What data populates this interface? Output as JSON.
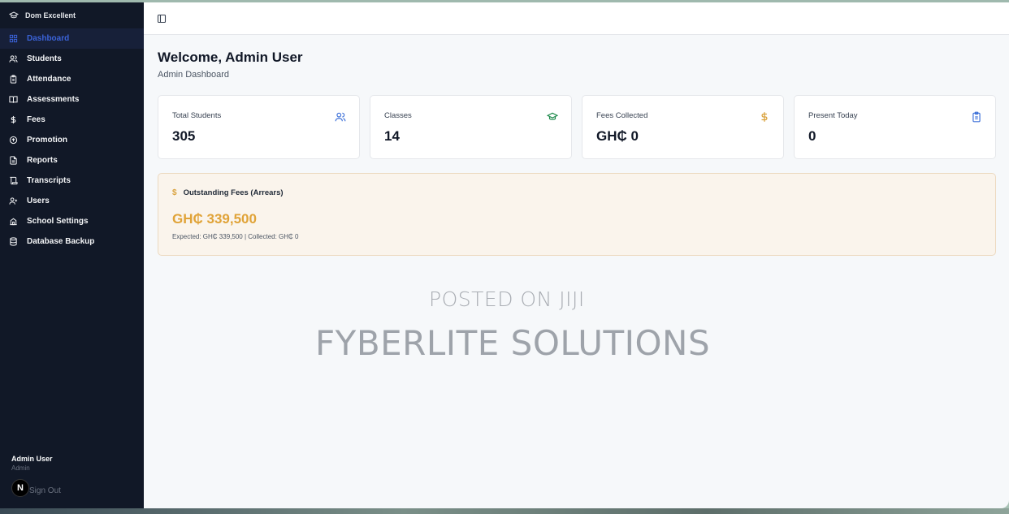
{
  "sidebar": {
    "brand": "Dom Excellent",
    "items": [
      {
        "label": "Dashboard",
        "icon": "dashboard-icon",
        "active": true
      },
      {
        "label": "Students",
        "icon": "users-icon"
      },
      {
        "label": "Attendance",
        "icon": "clipboard-icon"
      },
      {
        "label": "Assessments",
        "icon": "book-open-icon"
      },
      {
        "label": "Fees",
        "icon": "dollar-icon"
      },
      {
        "label": "Promotion",
        "icon": "arrow-circle-icon"
      },
      {
        "label": "Reports",
        "icon": "file-icon"
      },
      {
        "label": "Transcripts",
        "icon": "scroll-icon"
      },
      {
        "label": "Users",
        "icon": "user-plus-icon"
      },
      {
        "label": "School Settings",
        "icon": "school-icon"
      },
      {
        "label": "Database Backup",
        "icon": "database-icon"
      }
    ],
    "user": {
      "name": "Admin User",
      "role": "Admin"
    },
    "signout_label": "Sign Out",
    "next_badge": "N"
  },
  "header": {
    "welcome": "Welcome, Admin User",
    "subtitle": "Admin Dashboard"
  },
  "stats": [
    {
      "label": "Total Students",
      "value": "305",
      "icon": "users-icon",
      "color": "#3b6fd8"
    },
    {
      "label": "Classes",
      "value": "14",
      "icon": "graduation-cap-icon",
      "color": "#1f8a4c"
    },
    {
      "label": "Fees Collected",
      "value": "GH₵ 0",
      "icon": "dollar-icon",
      "color": "#d9a23e"
    },
    {
      "label": "Present Today",
      "value": "0",
      "icon": "clipboard-icon",
      "color": "#3b6fd8"
    }
  ],
  "arrears": {
    "title": "Outstanding Fees (Arrears)",
    "amount": "GH₵ 339,500",
    "detail": "Expected: GH₵ 339,500 | Collected: GH₵ 0"
  },
  "watermark": {
    "line1": "POSTED ON JIJI",
    "line2": "FYBERLITE SOLUTIONS"
  },
  "colors": {
    "sidebar_bg": "#111827",
    "active_text": "#3b63d9",
    "arrears_amount": "#e0a338"
  }
}
